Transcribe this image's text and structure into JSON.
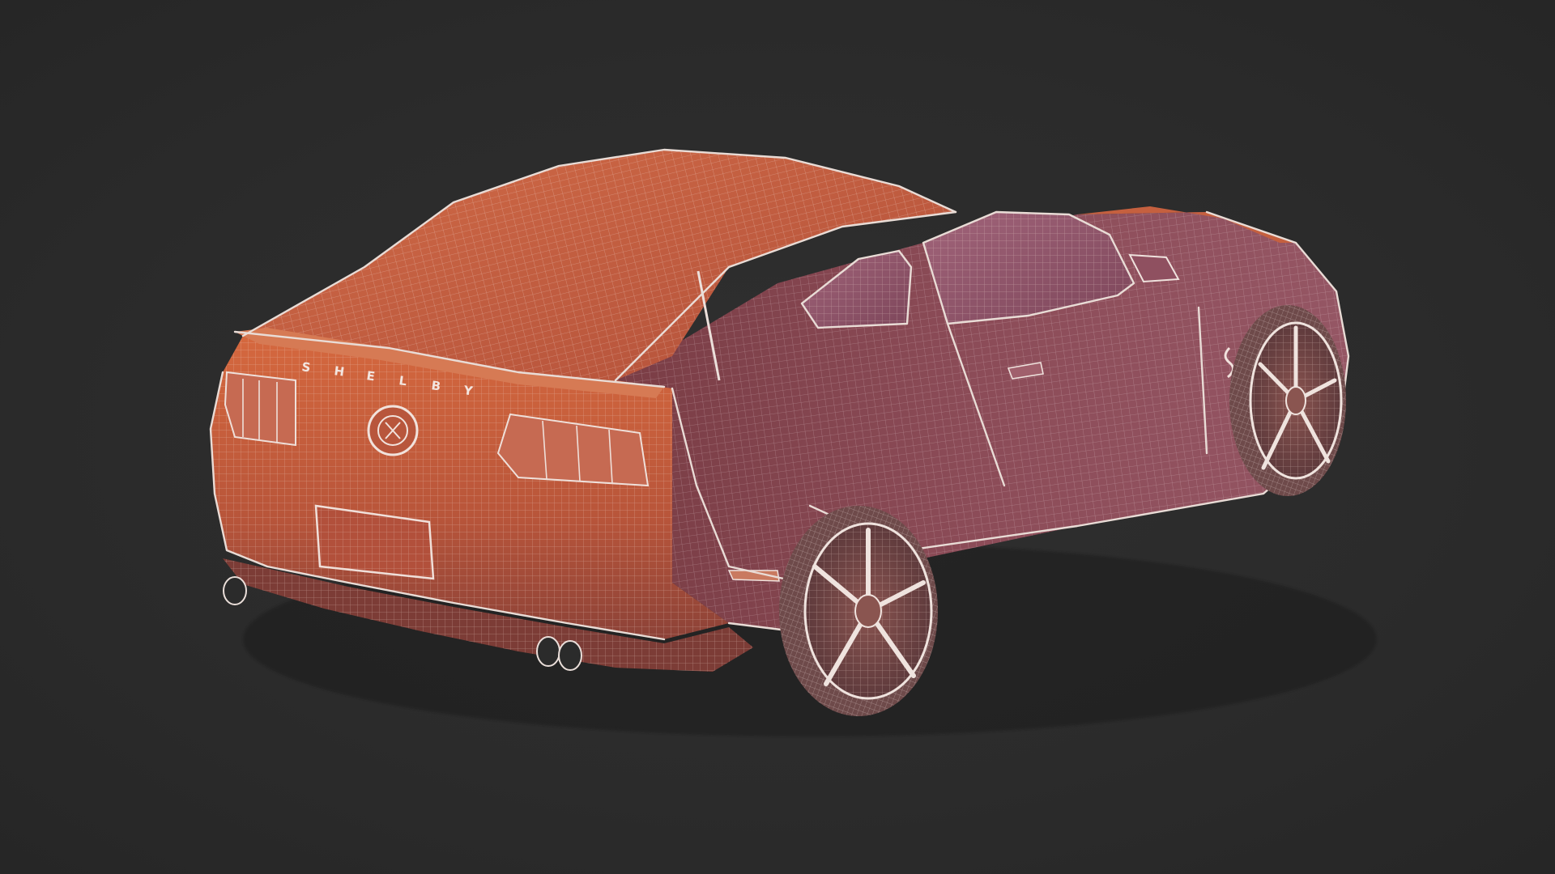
{
  "scene": {
    "background_color": "#2c2c2c",
    "subject": "car-wireframe",
    "mesh_color": "#e9dcd6",
    "body_colors": {
      "rear": "#c8603c",
      "roof": "#c35a3a",
      "side": "#8a4a55",
      "glass": "#94566a",
      "tire": "#7a5a58",
      "wheel": "#7e4f4b"
    },
    "lettering": "SHELBY"
  }
}
